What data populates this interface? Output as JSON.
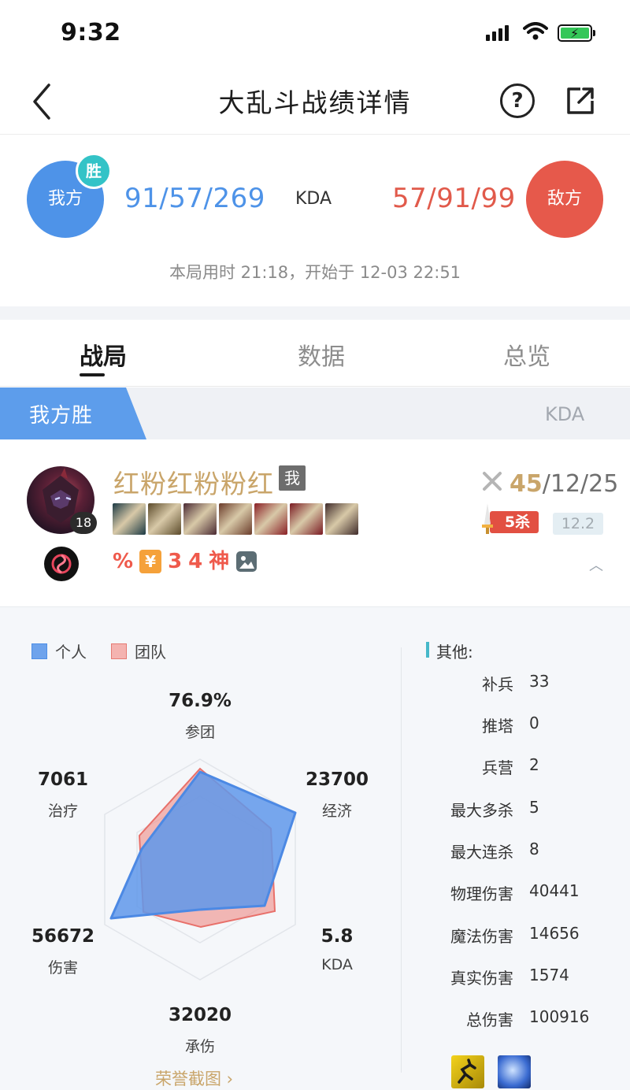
{
  "status_bar": {
    "time": "9:32"
  },
  "nav": {
    "title": "大乱斗战绩详情",
    "help_icon": "question-icon",
    "share_icon": "share-icon"
  },
  "score": {
    "our_team": "我方",
    "win_badge": "胜",
    "our_kda": "91/57/269",
    "kda_label": "KDA",
    "enemy_kda": "57/91/99",
    "enemy_team": "敌方",
    "match_info": "本局用时 21:18，开始于 12-03 22:51"
  },
  "tabs": [
    {
      "label": "战局",
      "active": true
    },
    {
      "label": "数据",
      "active": false
    },
    {
      "label": "总览",
      "active": false
    }
  ],
  "result": {
    "label": "我方胜",
    "kda_col": "KDA"
  },
  "player": {
    "name": "红粉红粉粉红",
    "me_tag": "我",
    "level": "18",
    "kills": "45",
    "rest_kda": "/12/25",
    "multikill": "5杀",
    "rating": "12.2",
    "tags": [
      "%",
      "¥",
      "3",
      "4",
      "神"
    ],
    "items": [
      "#1c3a44",
      "#5b4a2a",
      "#4a2a33",
      "#6a3b2a",
      "#8a1f25",
      "#7a1a22",
      "#3f2b2a"
    ]
  },
  "legend": {
    "personal": "个人",
    "team": "团队",
    "personal_color": "#6ea3ec",
    "team_color": "#f0a6a2"
  },
  "radar": {
    "participation": {
      "value": "76.9%",
      "label": "参团"
    },
    "gold": {
      "value": "23700",
      "label": "经济"
    },
    "kda": {
      "value": "5.8",
      "label": "KDA"
    },
    "taken": {
      "value": "32020",
      "label": "承伤"
    },
    "damage": {
      "value": "56672",
      "label": "伤害"
    },
    "heal": {
      "value": "7061",
      "label": "治疗"
    }
  },
  "others": {
    "title": "其他:",
    "rows": [
      {
        "label": "补兵",
        "value": "33"
      },
      {
        "label": "推塔",
        "value": "0"
      },
      {
        "label": "兵营",
        "value": "2"
      },
      {
        "label": "最大多杀",
        "value": "5"
      },
      {
        "label": "最大连杀",
        "value": "8"
      },
      {
        "label": "物理伤害",
        "value": "40441"
      },
      {
        "label": "魔法伤害",
        "value": "14656"
      },
      {
        "label": "真实伤害",
        "value": "1574"
      },
      {
        "label": "总伤害",
        "value": "100916"
      }
    ]
  },
  "honor_link": "荣誉截图 ›"
}
